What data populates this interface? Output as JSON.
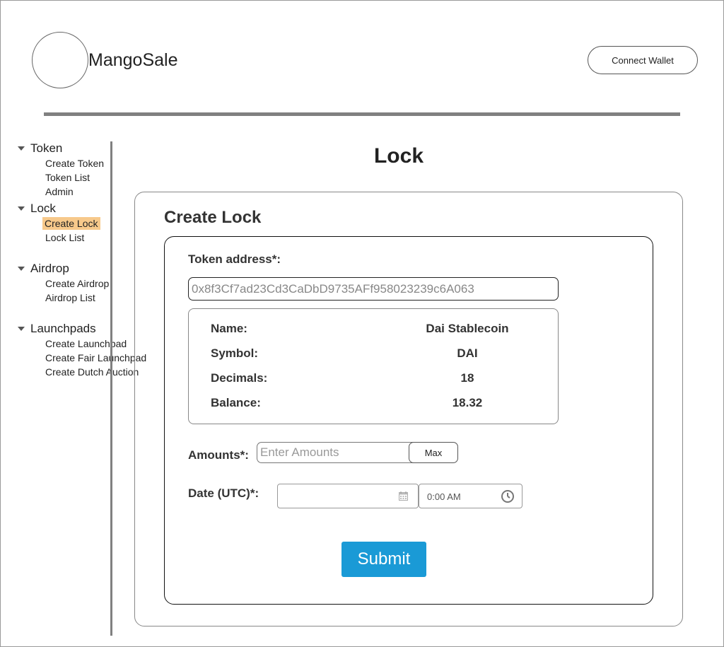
{
  "header": {
    "app_name": "MangoSale",
    "connect_wallet_label": "Connect Wallet"
  },
  "sidebar": {
    "groups": [
      {
        "label": "Token",
        "items": [
          {
            "label": "Create Token"
          },
          {
            "label": "Token List"
          },
          {
            "label": "Admin"
          }
        ]
      },
      {
        "label": "Lock",
        "items": [
          {
            "label": "Create Lock",
            "active": true
          },
          {
            "label": "Lock List"
          }
        ]
      },
      {
        "label": "Airdrop",
        "items": [
          {
            "label": "Create Airdrop"
          },
          {
            "label": "Airdrop List"
          }
        ]
      },
      {
        "label": "Launchpads",
        "items": [
          {
            "label": "Create Launchpad"
          },
          {
            "label": "Create Fair Launchpad"
          },
          {
            "label": "Create Dutch Auction"
          }
        ]
      }
    ],
    "active_highlight_color": "#f7c98b"
  },
  "main": {
    "page_title": "Lock",
    "card_title": "Create Lock",
    "token_address_label": "Token address*:",
    "token_address_value": "0x8f3Cf7ad23Cd3CaDbD9735AFf958023239c6A063",
    "token_info": [
      {
        "key": "Name:",
        "value": "Dai Stablecoin"
      },
      {
        "key": "Symbol:",
        "value": "DAI"
      },
      {
        "key": "Decimals:",
        "value": "18"
      },
      {
        "key": "Balance:",
        "value": "18.32"
      }
    ],
    "amounts_label": "Amounts*:",
    "amounts_placeholder": "Enter Amounts",
    "max_label": "Max",
    "date_label": "Date (UTC)*:",
    "date_value": "",
    "time_value": "0:00 AM",
    "submit_label": "Submit",
    "submit_color": "#1a9ad6"
  }
}
